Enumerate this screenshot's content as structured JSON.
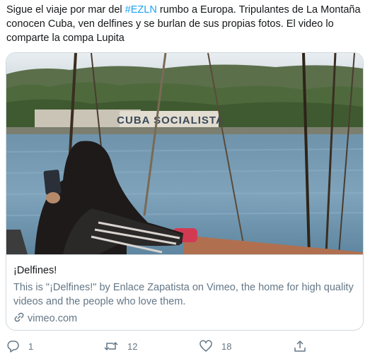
{
  "tweet": {
    "text_before": "Sigue el viaje por mar del ",
    "hashtag": "#EZLN",
    "text_after": " rumbo a Europa. Tripulantes de La Montaña conocen Cuba, ven delfines y se burlan de sus propias fotos. El video lo comparte la compa Lupita"
  },
  "card": {
    "image_sign_text": "CUBA SOCIALISTA",
    "title": "¡Delfines!",
    "description": "This is \"¡Delfines!\" by Enlace Zapatista on Vimeo, the home for high quality videos and the people who love them.",
    "domain": "vimeo.com",
    "link_icon": "link-icon"
  },
  "actions": {
    "reply": {
      "icon": "reply-icon",
      "count": "1"
    },
    "retweet": {
      "icon": "retweet-icon",
      "count": "12"
    },
    "like": {
      "icon": "heart-icon",
      "count": "18"
    },
    "share": {
      "icon": "share-icon"
    }
  },
  "colors": {
    "accent": "#1da1f2",
    "secondary_text": "#657786",
    "border": "#cfd9de"
  }
}
